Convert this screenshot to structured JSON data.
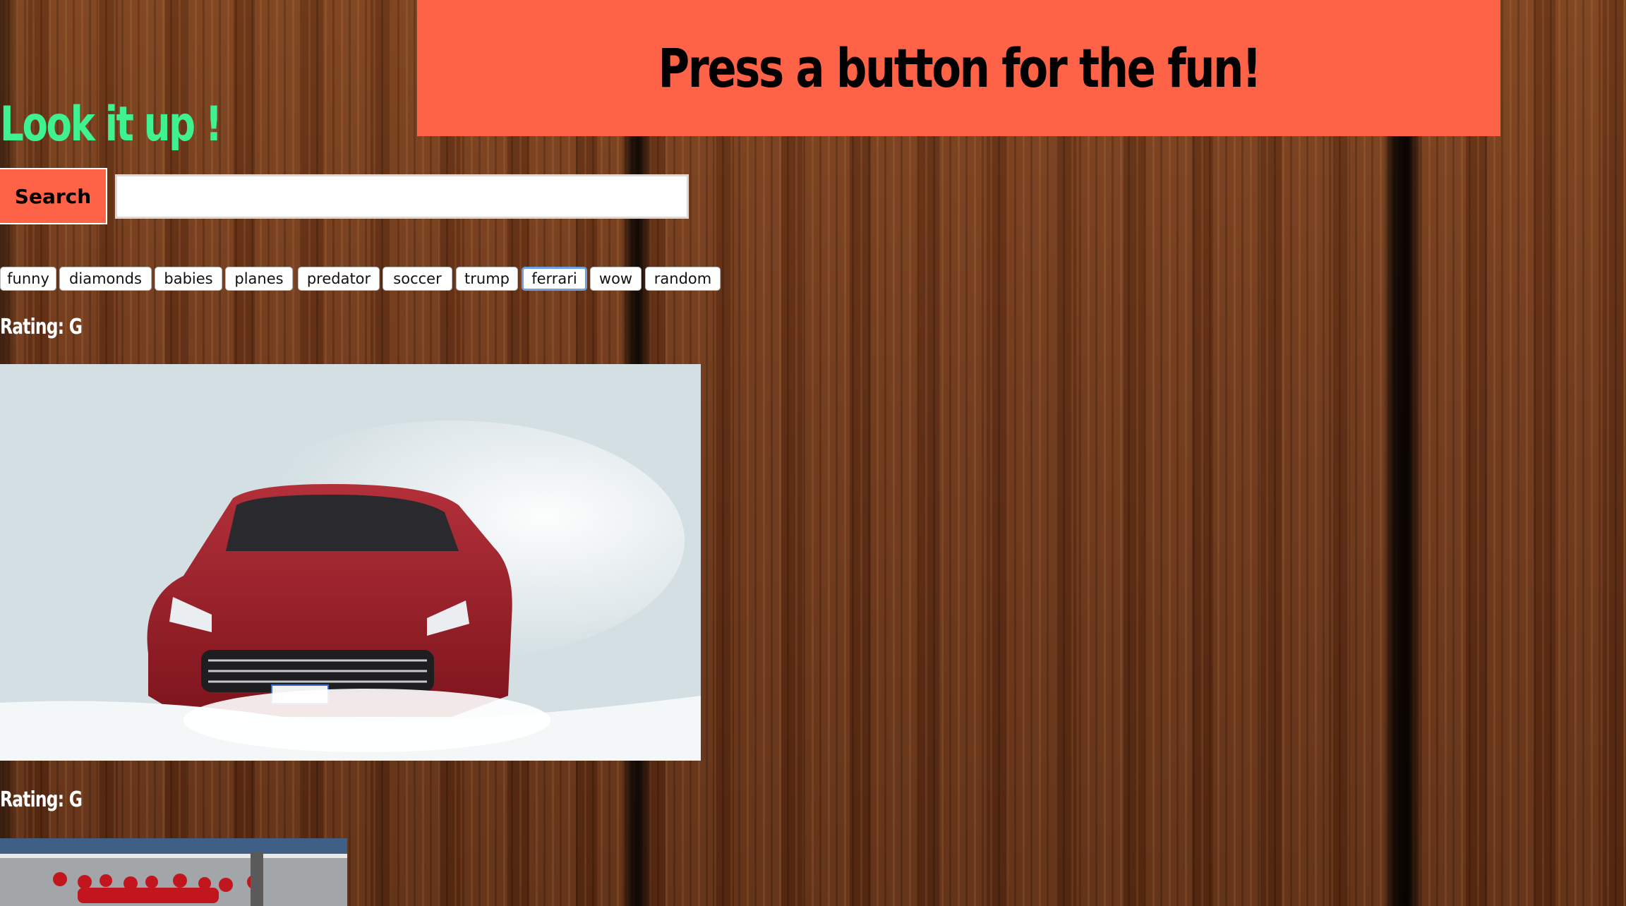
{
  "banner": {
    "title": "Press a button for the fun!"
  },
  "search_section": {
    "heading": "Look it up !",
    "button_label": "Search",
    "input_value": ""
  },
  "topics": [
    "funny",
    "diamonds",
    "babies",
    "planes",
    "predator",
    "soccer",
    "trump",
    "ferrari",
    "wow",
    "random"
  ],
  "focused_topic": "ferrari",
  "results": [
    {
      "rating": "Rating: G",
      "image_subject": "red Ferrari drifting in snow"
    },
    {
      "rating": "Rating: G",
      "image_subject": "Ferrari pit crew at race track"
    }
  ],
  "colors": {
    "accent": "#ff6347",
    "heading": "#3ff28f",
    "rating_text": "#ffffff"
  }
}
